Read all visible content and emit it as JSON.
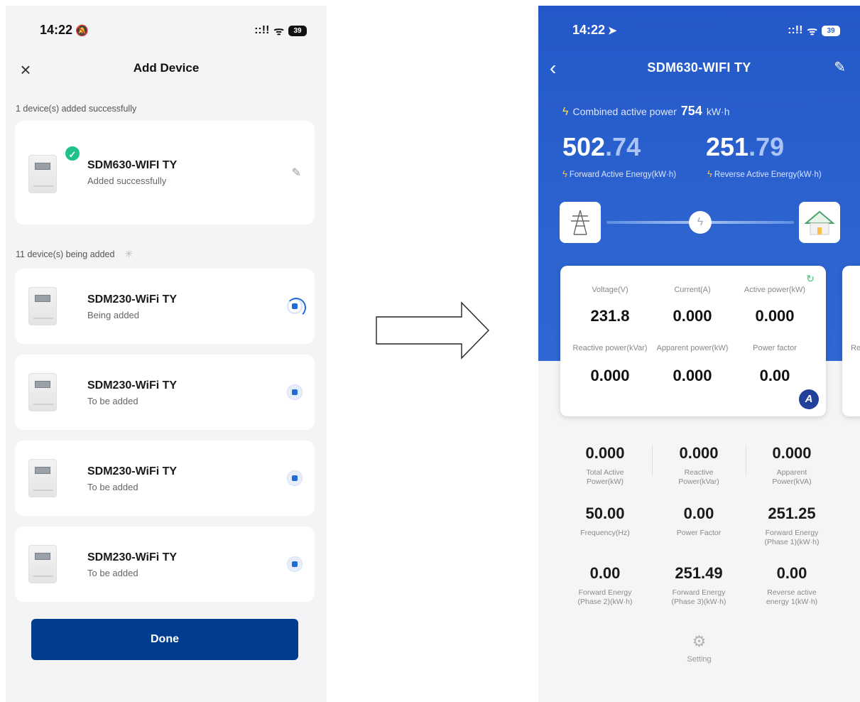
{
  "left_screen": {
    "status": {
      "time": "14:22",
      "time_extra": "🔕",
      "signal": "::!!",
      "wifi": "ᯤ",
      "battery": "39"
    },
    "close_label": "×",
    "title": "Add Device",
    "success_section": "1 device(s) added successfully",
    "adding_section": "11 device(s) being added",
    "success_device": {
      "name": "SDM630-WIFI TY",
      "status": "Added successfully",
      "edit_icon": "✎"
    },
    "devices": [
      {
        "name": "SDM230-WiFi TY",
        "status": "Being added"
      },
      {
        "name": "SDM230-WiFi TY",
        "status": "To be added"
      },
      {
        "name": "SDM230-WiFi TY",
        "status": "To be added"
      },
      {
        "name": "SDM230-WiFi TY",
        "status": "To be added"
      }
    ],
    "done_label": "Done"
  },
  "right_screen": {
    "status": {
      "time": "14:22",
      "time_extra": "➤",
      "signal": "::!!",
      "wifi": "ᯤ",
      "battery": "39"
    },
    "back_label": "‹",
    "title": "SDM630-WIFI TY",
    "edit_label": "✎",
    "combined": {
      "label": "Combined active power",
      "value": "754",
      "unit": "kW·h"
    },
    "forward": {
      "int": "502",
      "dec": ".74",
      "label": "Forward Active Energy(kW·h)"
    },
    "reverse": {
      "int": "251",
      "dec": ".79",
      "label": "Reverse Active Energy(kW·h)"
    },
    "meter_card": {
      "voltage": {
        "label": "Voltage(V)",
        "value": "231.8"
      },
      "current": {
        "label": "Current(A)",
        "value": "0.000"
      },
      "active": {
        "label": "Active power(kW)",
        "value": "0.000"
      },
      "reactive": {
        "label": "Reactive power(kVar)",
        "value": "0.000"
      },
      "apparent": {
        "label": "Apparent power(kW)",
        "value": "0.000"
      },
      "pf": {
        "label": "Power factor",
        "value": "0.00"
      },
      "phase": "A"
    },
    "peek_label": "Re",
    "grid": [
      {
        "value": "0.000",
        "label": "Total Active Power(kW)"
      },
      {
        "value": "0.000",
        "label": "Reactive Power(kVar)"
      },
      {
        "value": "0.000",
        "label": "Apparent Power(kVA)"
      },
      {
        "value": "50.00",
        "label": "Frequency(Hz)"
      },
      {
        "value": "0.00",
        "label": "Power Factor"
      },
      {
        "value": "251.25",
        "label": "Forward Energy (Phase 1)(kW·h)"
      },
      {
        "value": "0.00",
        "label": "Forward Energy (Phase 2)(kW·h)"
      },
      {
        "value": "251.49",
        "label": "Forward Energy (Phase 3)(kW·h)"
      },
      {
        "value": "0.00",
        "label": "Reverse active energy 1(kW·h)"
      }
    ],
    "setting_label": "Setting"
  },
  "colors": {
    "primary_button": "#003d8f",
    "header_blue": "#2c63cf",
    "success_green": "#1ec28b"
  }
}
